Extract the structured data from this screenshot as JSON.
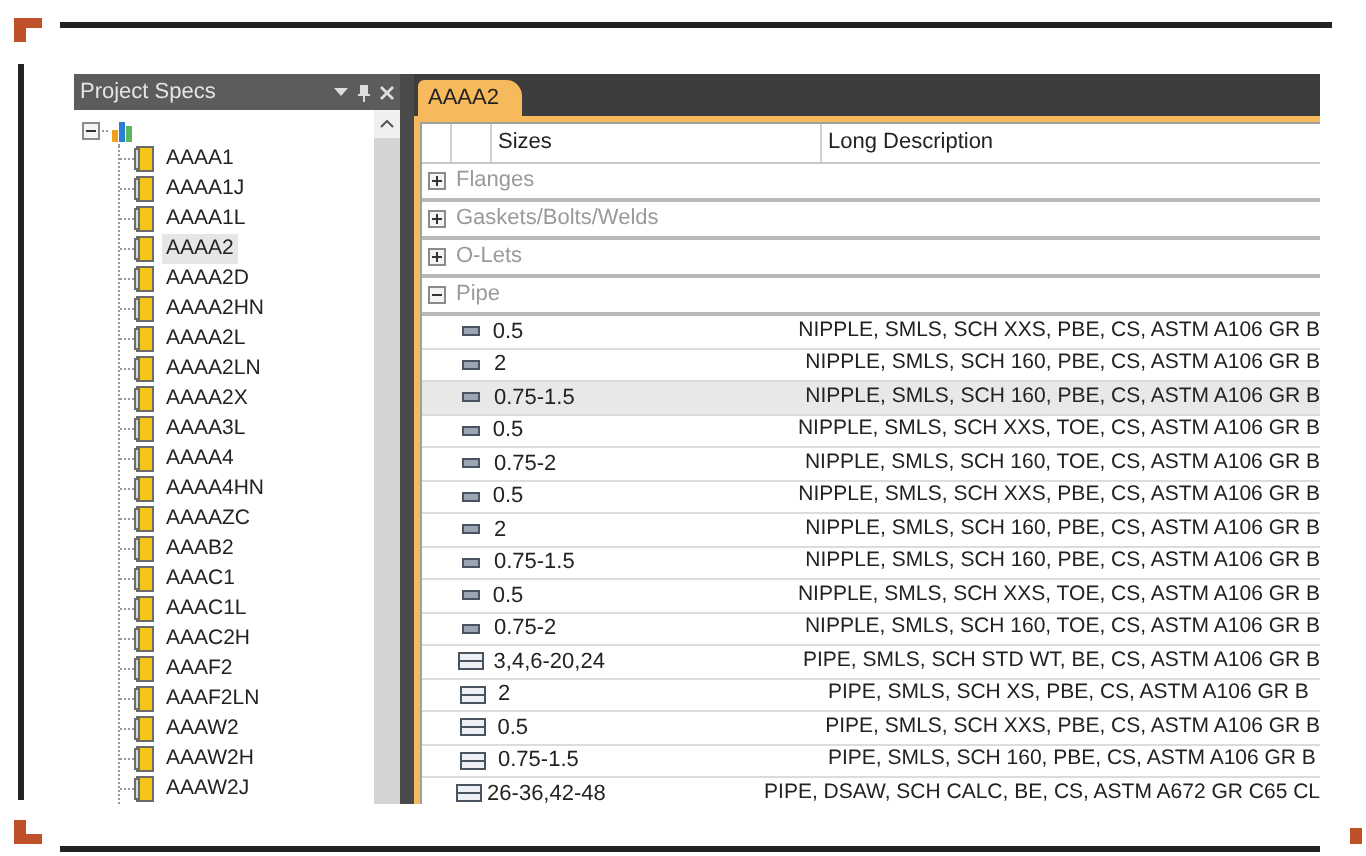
{
  "panel": {
    "title": "Project Specs",
    "root_expanded": true,
    "items": [
      {
        "label": "AAAA1",
        "selected": false
      },
      {
        "label": "AAAA1J",
        "selected": false
      },
      {
        "label": "AAAA1L",
        "selected": false
      },
      {
        "label": "AAAA2",
        "selected": true
      },
      {
        "label": "AAAA2D",
        "selected": false
      },
      {
        "label": "AAAA2HN",
        "selected": false
      },
      {
        "label": "AAAA2L",
        "selected": false
      },
      {
        "label": "AAAA2LN",
        "selected": false
      },
      {
        "label": "AAAA2X",
        "selected": false
      },
      {
        "label": "AAAA3L",
        "selected": false
      },
      {
        "label": "AAAA4",
        "selected": false
      },
      {
        "label": "AAAA4HN",
        "selected": false
      },
      {
        "label": "AAAAZC",
        "selected": false
      },
      {
        "label": "AAAB2",
        "selected": false
      },
      {
        "label": "AAAC1",
        "selected": false
      },
      {
        "label": "AAAC1L",
        "selected": false
      },
      {
        "label": "AAAC2H",
        "selected": false
      },
      {
        "label": "AAAF2",
        "selected": false
      },
      {
        "label": "AAAF2LN",
        "selected": false
      },
      {
        "label": "AAAW2",
        "selected": false
      },
      {
        "label": "AAAW2H",
        "selected": false
      },
      {
        "label": "AAAW2J",
        "selected": false
      }
    ]
  },
  "tab": {
    "label": "AAAA2",
    "selected": true
  },
  "table": {
    "columns": [
      "Sizes",
      "Long Description"
    ],
    "groups": [
      {
        "label": "Flanges",
        "expanded": false
      },
      {
        "label": "Gaskets/Bolts/Welds",
        "expanded": false
      },
      {
        "label": "O-Lets",
        "expanded": false
      },
      {
        "label": "Pipe",
        "expanded": true,
        "rows": [
          {
            "kind": "nipple",
            "size": "0.5",
            "description": "NIPPLE, SMLS, SCH XXS, PBE, CS, ASTM A106 GR B",
            "selected": false
          },
          {
            "kind": "nipple",
            "size": "2",
            "description": "NIPPLE, SMLS, SCH 160, PBE, CS, ASTM A106 GR B",
            "selected": false
          },
          {
            "kind": "nipple",
            "size": "0.75-1.5",
            "description": "NIPPLE, SMLS, SCH 160, PBE, CS, ASTM A106 GR B",
            "selected": true
          },
          {
            "kind": "nipple",
            "size": "0.5",
            "description": "NIPPLE, SMLS, SCH XXS, TOE, CS, ASTM A106 GR B",
            "selected": false
          },
          {
            "kind": "nipple",
            "size": "0.75-2",
            "description": "NIPPLE, SMLS, SCH 160, TOE, CS, ASTM A106 GR B",
            "selected": false
          },
          {
            "kind": "nipple",
            "size": "0.5",
            "description": "NIPPLE, SMLS, SCH XXS, PBE, CS, ASTM A106 GR B",
            "selected": false
          },
          {
            "kind": "nipple",
            "size": "2",
            "description": "NIPPLE, SMLS, SCH 160, PBE, CS, ASTM A106 GR B",
            "selected": false
          },
          {
            "kind": "nipple",
            "size": "0.75-1.5",
            "description": "NIPPLE, SMLS, SCH 160, PBE, CS, ASTM A106 GR B",
            "selected": false
          },
          {
            "kind": "nipple",
            "size": "0.5",
            "description": "NIPPLE, SMLS, SCH XXS, TOE, CS, ASTM A106 GR B",
            "selected": false
          },
          {
            "kind": "nipple",
            "size": "0.75-2",
            "description": "NIPPLE, SMLS, SCH 160, TOE, CS, ASTM A106 GR B",
            "selected": false
          },
          {
            "kind": "pipe",
            "size": "3,4,6-20,24",
            "description": "PIPE, SMLS, SCH STD WT, BE, CS, ASTM A106 GR B",
            "selected": false
          },
          {
            "kind": "pipe",
            "size": "2",
            "description": "PIPE, SMLS, SCH XS, PBE, CS, ASTM A106 GR B",
            "selected": false
          },
          {
            "kind": "pipe",
            "size": "0.5",
            "description": "PIPE, SMLS, SCH XXS, PBE, CS, ASTM A106 GR B",
            "selected": false
          },
          {
            "kind": "pipe",
            "size": "0.75-1.5",
            "description": "PIPE, SMLS, SCH 160, PBE, CS, ASTM A106 GR B",
            "selected": false
          },
          {
            "kind": "pipe",
            "size": "26-36,42-48",
            "description": "PIPE, DSAW, SCH CALC, BE, CS, ASTM A672 GR C65 CL",
            "selected": false
          }
        ]
      }
    ]
  }
}
